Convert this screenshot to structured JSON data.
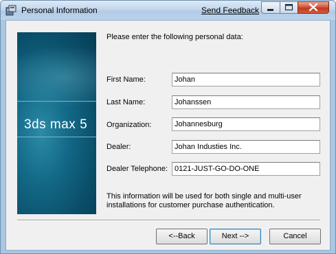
{
  "window": {
    "title": "Personal Information",
    "feedback_link": "Send Feedback"
  },
  "banner": {
    "logo": "3ds max 5"
  },
  "form": {
    "intro": "Please enter the following personal data:",
    "fields": [
      {
        "label": "First Name:",
        "value": "Johan"
      },
      {
        "label": "Last Name:",
        "value": "Johanssen"
      },
      {
        "label": "Organization:",
        "value": "Johannesburg"
      },
      {
        "label": "Dealer:",
        "value": "Johan Industies Inc."
      },
      {
        "label": "Dealer Telephone:",
        "value": "0121-JUST-GO-DO-ONE"
      }
    ],
    "footer": "This information will be used for both single and multi-user installations for customer purchase authentication."
  },
  "buttons": {
    "back": "<--Back",
    "next": "Next -->",
    "cancel": "Cancel"
  },
  "icons": {
    "app": "installer-icon",
    "minimize": "minimize-icon",
    "maximize": "maximize-icon",
    "close": "close-icon"
  }
}
